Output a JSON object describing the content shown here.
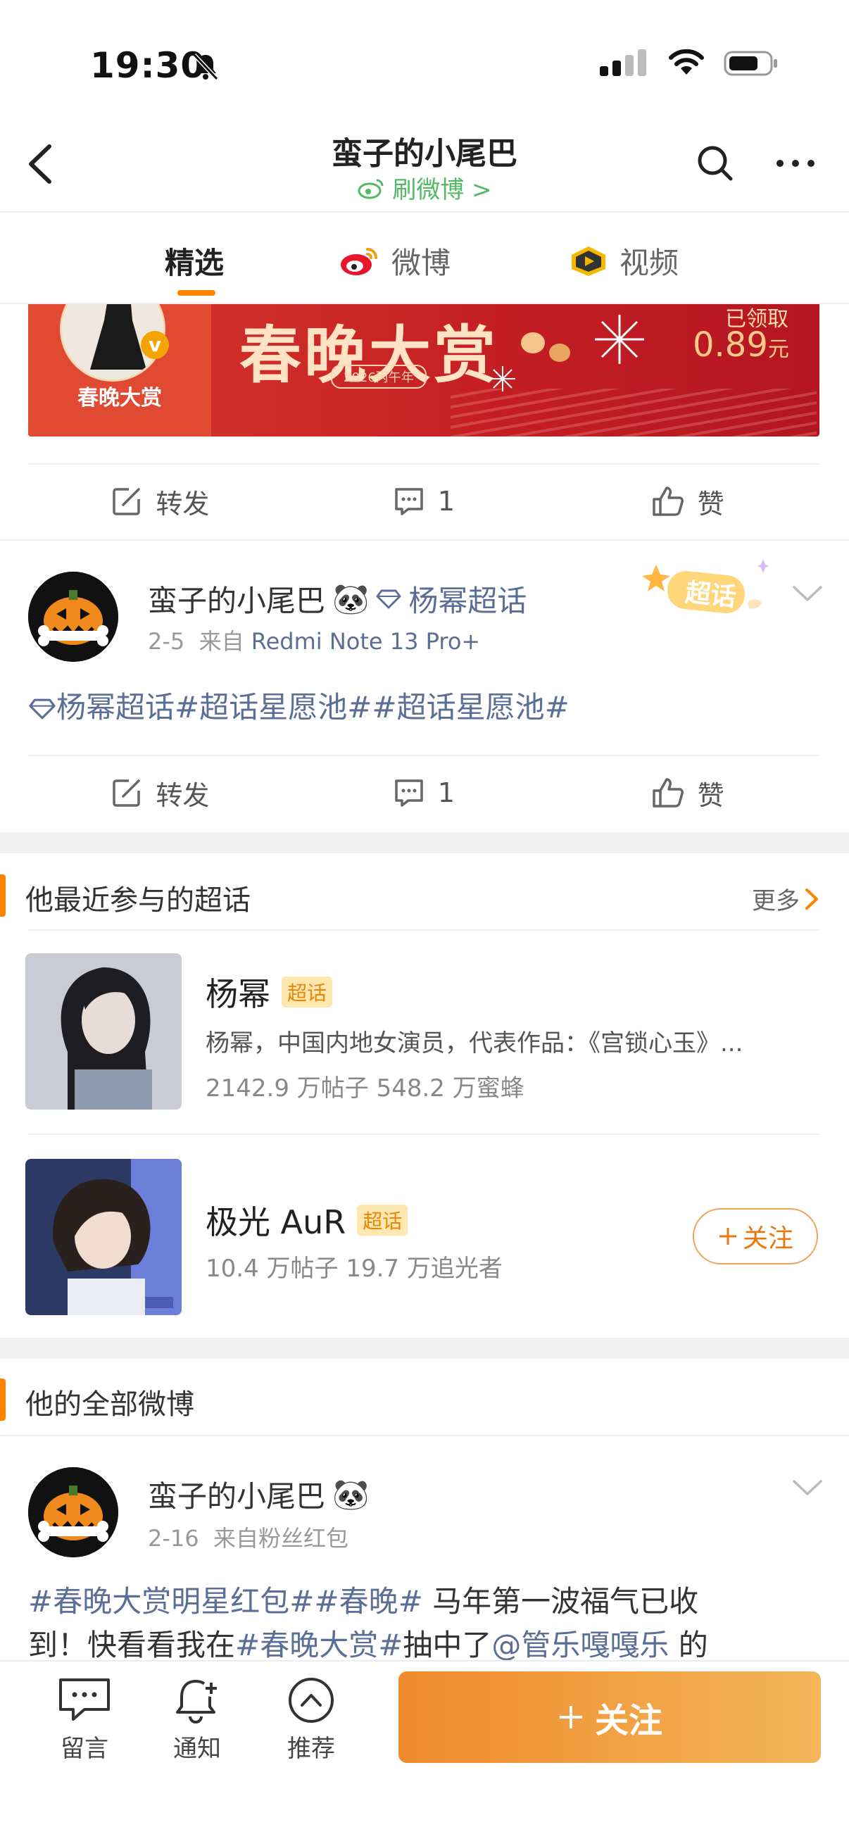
{
  "status_bar": {
    "time": "19:30"
  },
  "nav": {
    "title": "蛮子的小尾巴",
    "subtitle": "刷微博 >"
  },
  "tabs": [
    {
      "label": "精选",
      "active": true
    },
    {
      "label": "微博",
      "active": false
    },
    {
      "label": "视频",
      "active": false
    }
  ],
  "banner": {
    "caption": "春晚大赏",
    "title": "春晚大赏",
    "year": "2026丙午年",
    "received_label": "已领取",
    "amount": "0.89",
    "amount_unit": "元",
    "vbadge": "v"
  },
  "actions1": {
    "repost": "转发",
    "comment": "1",
    "like": "赞"
  },
  "post1": {
    "author": "蛮子的小尾巴",
    "emoji": "🐼",
    "topic_tag": "杨幂超话",
    "date": "2-5",
    "source_prefix": "来自",
    "source": "Redmi Note 13 Pro+",
    "sticker": "超话",
    "text_parts": [
      "杨幂超话",
      "#超话星愿池#",
      "#超话星愿池#"
    ]
  },
  "actions2": {
    "repost": "转发",
    "comment": "1",
    "like": "赞"
  },
  "section_topics": {
    "title": "他最近参与的超话",
    "more": "更多",
    "items": [
      {
        "name": "杨幂",
        "badge": "超话",
        "desc": "杨幂，中国内地女演员，代表作品：《宫锁心玉》...",
        "stats": "2142.9 万帖子 548.2 万蜜蜂"
      },
      {
        "name": "极光 AuR",
        "badge": "超话",
        "stats": "10.4 万帖子 19.7 万追光者",
        "follow": "关注"
      }
    ]
  },
  "section_all": {
    "title": "他的全部微博"
  },
  "post2": {
    "author": "蛮子的小尾巴",
    "emoji": "🐼",
    "date": "2-16",
    "source_prefix": "来自",
    "source": "粉丝红包",
    "line1_tag1": "#春晚大赏明星红包#",
    "line1_tag2": "#春晚#",
    "line1_text": " 马年第一波福气已收",
    "line2_text1": "到！快看看我在",
    "line2_tag": "#春晚大赏#",
    "line2_text2": "抽中了",
    "line2_mention": "@管乐嘎嘎乐",
    "line2_text3": " 的"
  },
  "bottom_bar": {
    "message": "留言",
    "notify": "通知",
    "recommend": "推荐",
    "follow": "关注"
  },
  "colors": {
    "accent": "#ff8200",
    "link": "#5b6e95",
    "green": "#54b864"
  }
}
